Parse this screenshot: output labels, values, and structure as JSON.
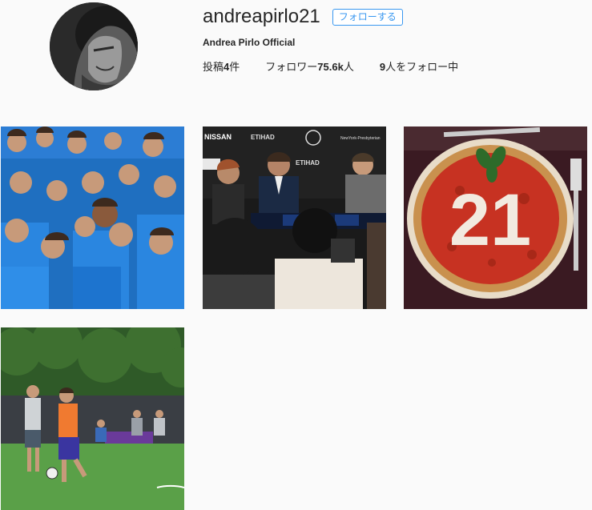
{
  "profile": {
    "username": "andreapirlo21",
    "follow_label": "フォローする",
    "full_name": "Andrea Pirlo Official"
  },
  "stats": {
    "posts_prefix": "投稿",
    "posts_count": "4",
    "posts_suffix": "件",
    "followers_prefix": "フォロワー",
    "followers_count": "75.6k",
    "followers_suffix": "人",
    "following_count": "9",
    "following_suffix": "人をフォロー中"
  },
  "posts": [
    {
      "name": "post-kids-camp"
    },
    {
      "name": "post-press-conference",
      "sponsor_1": "NISSAN",
      "sponsor_2": "ETIHAD",
      "sponsor_3": "NewYork-Presbyterian"
    },
    {
      "name": "post-pizza-21",
      "number": "21"
    },
    {
      "name": "post-training-field"
    }
  ],
  "colors": {
    "accent": "#3897f0",
    "background": "#fafafa",
    "text": "#262626"
  }
}
